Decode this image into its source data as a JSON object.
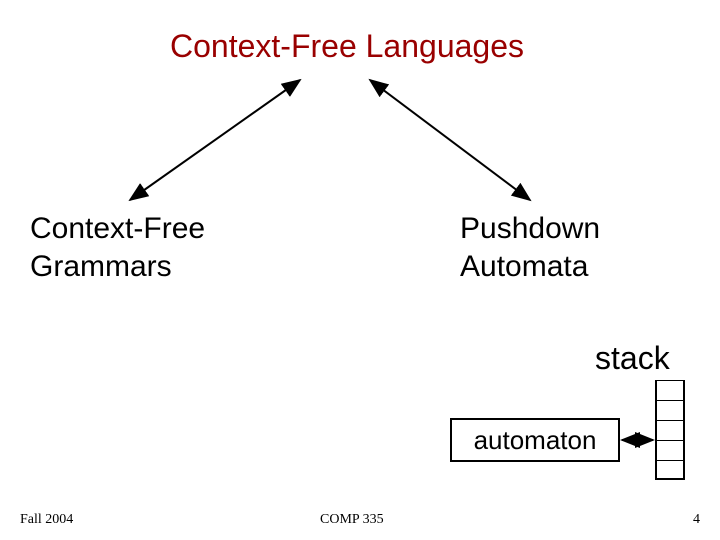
{
  "title": "Context-Free Languages",
  "left_node": {
    "line1": "Context-Free",
    "line2": "Grammars"
  },
  "right_node": {
    "line1": "Pushdown",
    "line2": "Automata"
  },
  "stack_label": "stack",
  "automaton_label": "automaton",
  "footer": {
    "left": "Fall 2004",
    "center": "COMP 335",
    "right": "4"
  },
  "colors": {
    "title": "#990000",
    "text": "#000000"
  }
}
